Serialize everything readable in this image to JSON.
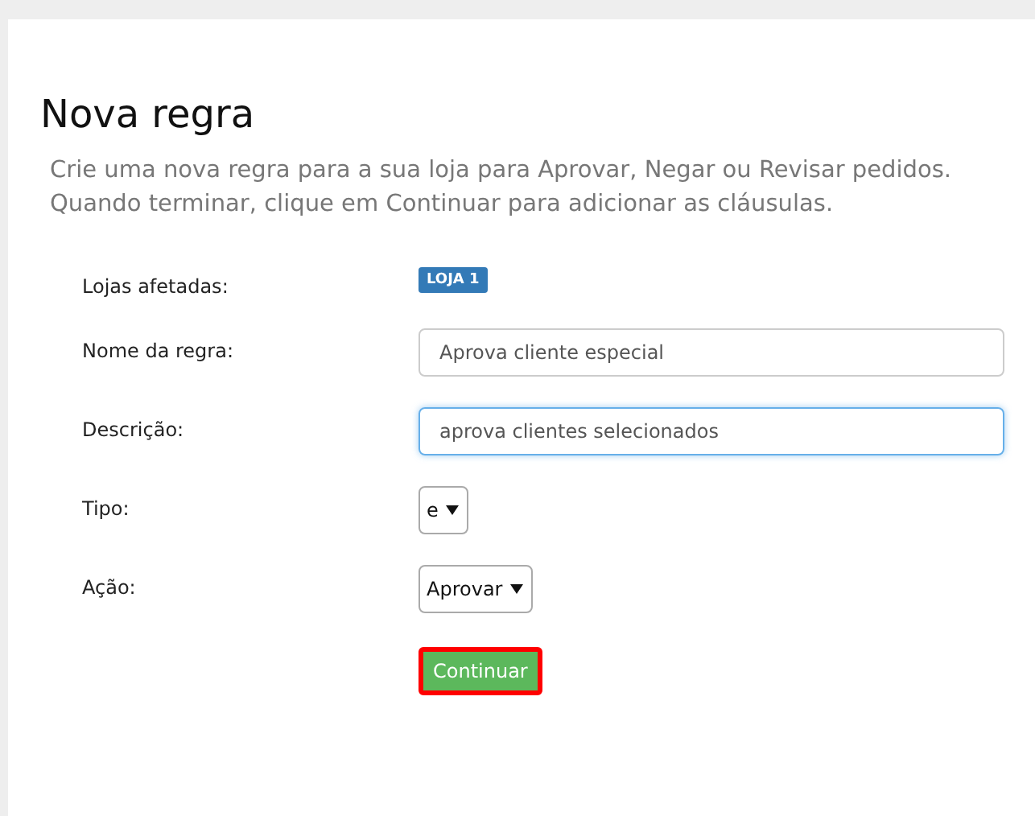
{
  "title": "Nova regra",
  "description": [
    "Crie uma nova regra para a sua loja para Aprovar, Negar ou Revisar pedidos.",
    "Quando terminar, clique em Continuar para adicionar as cláusulas."
  ],
  "fields": [
    {
      "label": "Lojas afetadas:",
      "kind": "badge",
      "value": "LOJA 1"
    },
    {
      "label": "Nome da regra:",
      "kind": "text",
      "value": "Aprova cliente especial",
      "focused": false
    },
    {
      "label": "Descrição:",
      "kind": "text",
      "value": "aprova clientes selecionados",
      "focused": true
    },
    {
      "label": "Tipo:",
      "kind": "select",
      "value": "e"
    },
    {
      "label": "Ação:",
      "kind": "select",
      "value": "Aprovar"
    }
  ],
  "button": {
    "label": "Continuar",
    "highlighted": true
  }
}
